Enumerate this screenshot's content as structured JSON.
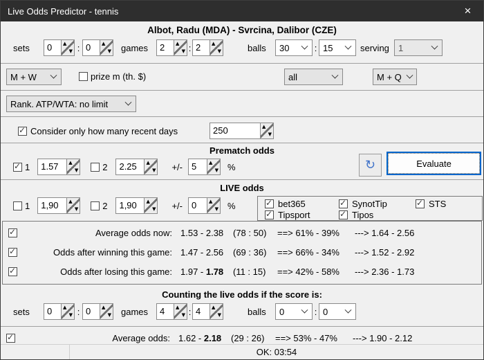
{
  "colors": {
    "accent_blue": "#0066cc",
    "refresh_icon_blue": "#3f72c9",
    "titlebar_bg": "#2e2e2e"
  },
  "icons": {
    "close": "×",
    "refresh": "↻",
    "spinner_up": "▲",
    "spinner_down": "▼"
  },
  "window": {
    "title": "Live Odds Predictor - tennis"
  },
  "match_header": "Albot, Radu (MDA) - Svrcina, Dalibor (CZE)",
  "punct": {
    "colon": ":"
  },
  "score": {
    "sets_label": "sets",
    "sets_a": "0",
    "sets_b": "0",
    "games_label": "games",
    "games_a": "2",
    "games_b": "2",
    "balls_label": "balls",
    "balls_a": "30",
    "balls_b": "15",
    "serving_label": "serving",
    "serving": "1"
  },
  "filters": {
    "category": "M + W",
    "prize_label": "prize m (th. $)",
    "tour_filter": "all",
    "quali": "M + Q",
    "rank": "Rank. ATP/WTA: no limit"
  },
  "recent_days": {
    "label": "Consider only how many recent days",
    "value": "250"
  },
  "prematch": {
    "header": "Prematch odds",
    "p1": "1",
    "odds1": "1.57",
    "p2": "2",
    "odds2": "2.25",
    "margin_label": "+/-",
    "margin": "5",
    "percent": "%",
    "evaluate": "Evaluate"
  },
  "live": {
    "header": "LIVE odds",
    "p1": "1",
    "odds1": "1,90",
    "p2": "2",
    "odds2": "1,90",
    "margin_label": "+/-",
    "margin": "0",
    "percent": "%",
    "bookmakers": {
      "row1": [
        "bet365",
        "SynotTip",
        "STS"
      ],
      "row2": [
        "Tipsport",
        "Tipos"
      ]
    }
  },
  "results": {
    "rows": [
      {
        "label": "Average odds now:",
        "odds_normal": "1.53 - 2.38",
        "odds_bold": "",
        "count": "(78 : 50)",
        "pct": "==> 61%  -  39%",
        "proj": "---> 1.64  -  2.56"
      },
      {
        "label": "Odds after winning this game:",
        "odds_normal": "1.47 - 2.56",
        "odds_bold": "",
        "count": "(69 : 36)",
        "pct": "==> 66%  -  34%",
        "proj": "---> 1.52  -  2.92"
      },
      {
        "label": "Odds after losing this game:",
        "odds_normal": "1.97 - ",
        "odds_bold": "1.78",
        "count": "(11 : 15)",
        "pct": "==> 42%  -  58%",
        "proj": "---> 2.36  -  1.73"
      }
    ]
  },
  "counting": {
    "header": "Counting the live odds if the score is:",
    "sets_label": "sets",
    "sets_a": "0",
    "sets_b": "0",
    "games_label": "games",
    "games_a": "4",
    "games_b": "4",
    "balls_label": "balls",
    "balls_a": "0",
    "balls_b": "0"
  },
  "average": {
    "label": "Average odds:",
    "odds_normal": "1.62 - ",
    "odds_bold": "2.18",
    "count": "(29 : 26)",
    "pct": "==> 53%  -  47%",
    "proj": "---> 1.90  -  2.12"
  },
  "statusbar": {
    "text": "OK: 03:54"
  }
}
